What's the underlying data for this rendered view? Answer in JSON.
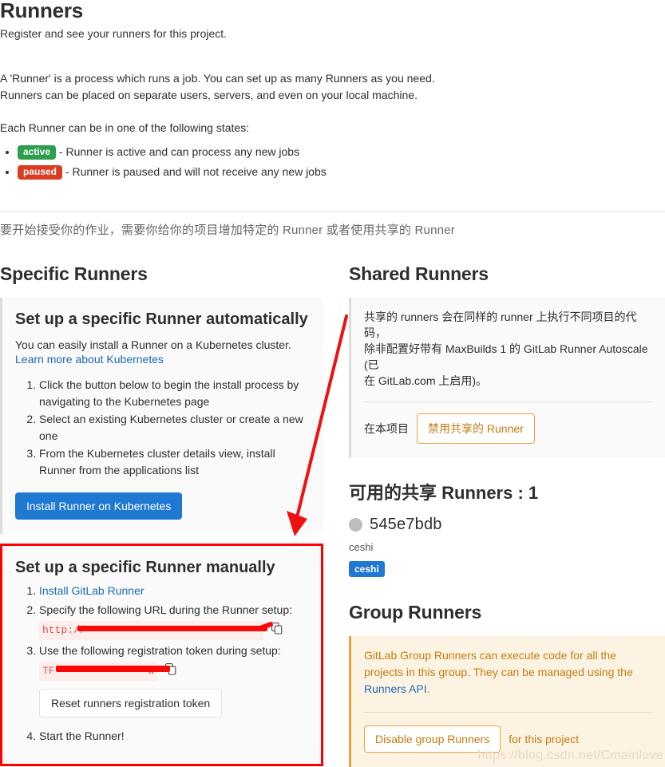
{
  "header": {
    "title": "Runners",
    "subtitle": "Register and see your runners for this project.",
    "intro_line1": "A 'Runner' is a process which runs a job. You can set up as many Runners as you need.",
    "intro_line2": "Runners can be placed on separate users, servers, and even on your local machine.",
    "states_intro": "Each Runner can be in one of the following states:",
    "states": [
      {
        "badge": "active",
        "badge_color": "#2e9e4d",
        "text": "- Runner is active and can process any new jobs"
      },
      {
        "badge": "paused",
        "badge_color": "#db3b21",
        "text": "- Runner is paused and will not receive any new jobs"
      }
    ],
    "cn_lead": "要开始接受你的作业，需要你给你的项目增加特定的 Runner 或者使用共享的 Runner"
  },
  "specific": {
    "section_title": "Specific Runners",
    "auto": {
      "title": "Set up a specific Runner automatically",
      "description": "You can easily install a Runner on a Kubernetes cluster.",
      "link_label": "Learn more about Kubernetes",
      "steps": [
        "Click the button below to begin the install process by navigating to the Kubernetes page",
        "Select an existing Kubernetes cluster or create a new one",
        "From the Kubernetes cluster details view, install Runner from the applications list"
      ],
      "install_button": "Install Runner on Kubernetes",
      "install_button_color": "#1f78d1"
    },
    "manual": {
      "title": "Set up a specific Runner manually",
      "highlight_color": "#ff0000",
      "step1_link": "Install GitLab Runner",
      "step2_text": "Specify the following URL during the Runner setup:",
      "url_prefix": "http://",
      "url_redacted": "███████████████████████████/",
      "step3_text": "Use the following registration token during setup:",
      "token_prefix": "TF",
      "token_redacted": "███████████████W",
      "reset_button": "Reset runners registration token",
      "step4_text": "Start the Runner!",
      "copy_icon_name": "copy-icon"
    }
  },
  "shared": {
    "section_title": "Shared Runners",
    "description_line1": "共享的 runners 会在同样的 runner 上执行不同项目的代码，",
    "description_line2": "除非配置好带有 MaxBuilds 1 的 GitLab Runner Autoscale (已",
    "description_line3": "在 GitLab.com 上启用)。",
    "toggle_prefix": "在本项目",
    "disable_button": "禁用共享的 Runner",
    "disable_button_color": "#e8a33d",
    "available_heading": "可用的共享 Runners : 1",
    "runner": {
      "status": "offline",
      "status_color": "#bdbdbd",
      "id": "545e7bdb",
      "description": "ceshi",
      "tag": "ceshi",
      "tag_color": "#1f78d1"
    }
  },
  "group": {
    "section_title": "Group Runners",
    "description_part1": "GitLab Group Runners can execute code for all the projects in this group. They can be managed using the ",
    "description_link": "Runners API",
    "description_part2": ".",
    "disable_button": "Disable group Runners",
    "suffix_text": "for this project",
    "accent_color": "#e8a33d"
  },
  "watermark": "https://blog.csdn.net/Cmainlove"
}
